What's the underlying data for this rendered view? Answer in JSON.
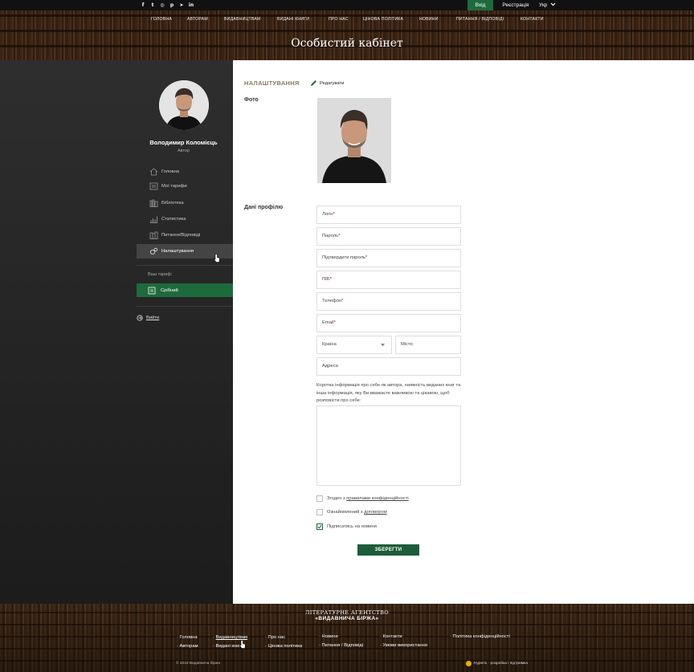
{
  "topbar": {
    "social_icons": [
      "facebook-icon",
      "twitter-icon",
      "instagram-icon",
      "pinterest-icon",
      "telegram-icon",
      "linkedin-icon"
    ],
    "social_glyphs": [
      "f",
      "t",
      "◎",
      "p",
      "➤",
      "in"
    ],
    "login": "Вхід",
    "register": "Реєстрація",
    "language": "Укр"
  },
  "nav": [
    "ГОЛОВНА",
    "АВТОРАМ",
    "ВИДАВНИЦТВАМ",
    "ВИДАНІ КНИГИ",
    "ПРО НАС",
    "ЦІНОВА ПОЛІТИКА",
    "НОВИНИ",
    "ПИТАННЯ / ВІДПОВІДІ",
    "КОНТАКТИ"
  ],
  "header_title": "Особистий кабінет",
  "sidebar": {
    "name": "Володимир Коломієць",
    "role": "Автор",
    "items": [
      {
        "label": "Головна",
        "icon": "home-icon"
      },
      {
        "label": "Мої тарифи",
        "icon": "tariffs-icon"
      },
      {
        "label": "Бібліотека",
        "icon": "library-icon"
      },
      {
        "label": "Статистика",
        "icon": "chart-icon"
      },
      {
        "label": "Питання/Відповіді",
        "icon": "books-icon"
      },
      {
        "label": "Налаштування",
        "icon": "settings-icon"
      }
    ],
    "tariff_label": "Ваш тариф:",
    "tariff": "Срібний",
    "logout": "Вийти"
  },
  "main": {
    "section_title": "НАЛАШТУВАННЯ",
    "edit": "Редагувати",
    "photo_label": "Фото",
    "profile_label": "Дані профілю",
    "fields": {
      "login": "Логін",
      "password": "Пароль",
      "confirm": "Підтвердити пароль",
      "fullname": "ПІБ",
      "phone": "Телефон",
      "email": "Email",
      "country": "Країна",
      "city": "Місто",
      "address": "Адреса"
    },
    "required_mark": "*",
    "about": "Коротка інформація про себе як автора, наявність виданих книг та інша інформація, яку Ви вважаєте важливою та цікавою, щоб розповісти про себе:",
    "checks": {
      "privacy_prefix": "Згоден з ",
      "privacy_link": "правилами конфіденційності",
      "contract_prefix": "Ознайомлений з ",
      "contract_link": "договором",
      "news": "Підписатись на новини"
    },
    "news_checked": true,
    "save": "ЗБЕРЕГТИ"
  },
  "footer": {
    "logo_line1": "ЛІТЕРАТУРНЕ АГЕНТСТВО",
    "logo_line2": "«ВИДАВНИЧА БІРЖА»",
    "links": {
      "home": "Головна",
      "authors": "Авторам",
      "publishers": "Видавництвам",
      "books": "Видані книги",
      "about": "Про нас",
      "pricing": "Цінова політика",
      "news": "Новини",
      "faq": "Питання / Відповіді",
      "contacts": "Контакти",
      "terms": "Умови використання",
      "privacy": "Політика конфіденційності"
    },
    "copyright": "© 2018 Видавнича біржа",
    "developer": "Hyperix · розробка і підтримка"
  }
}
